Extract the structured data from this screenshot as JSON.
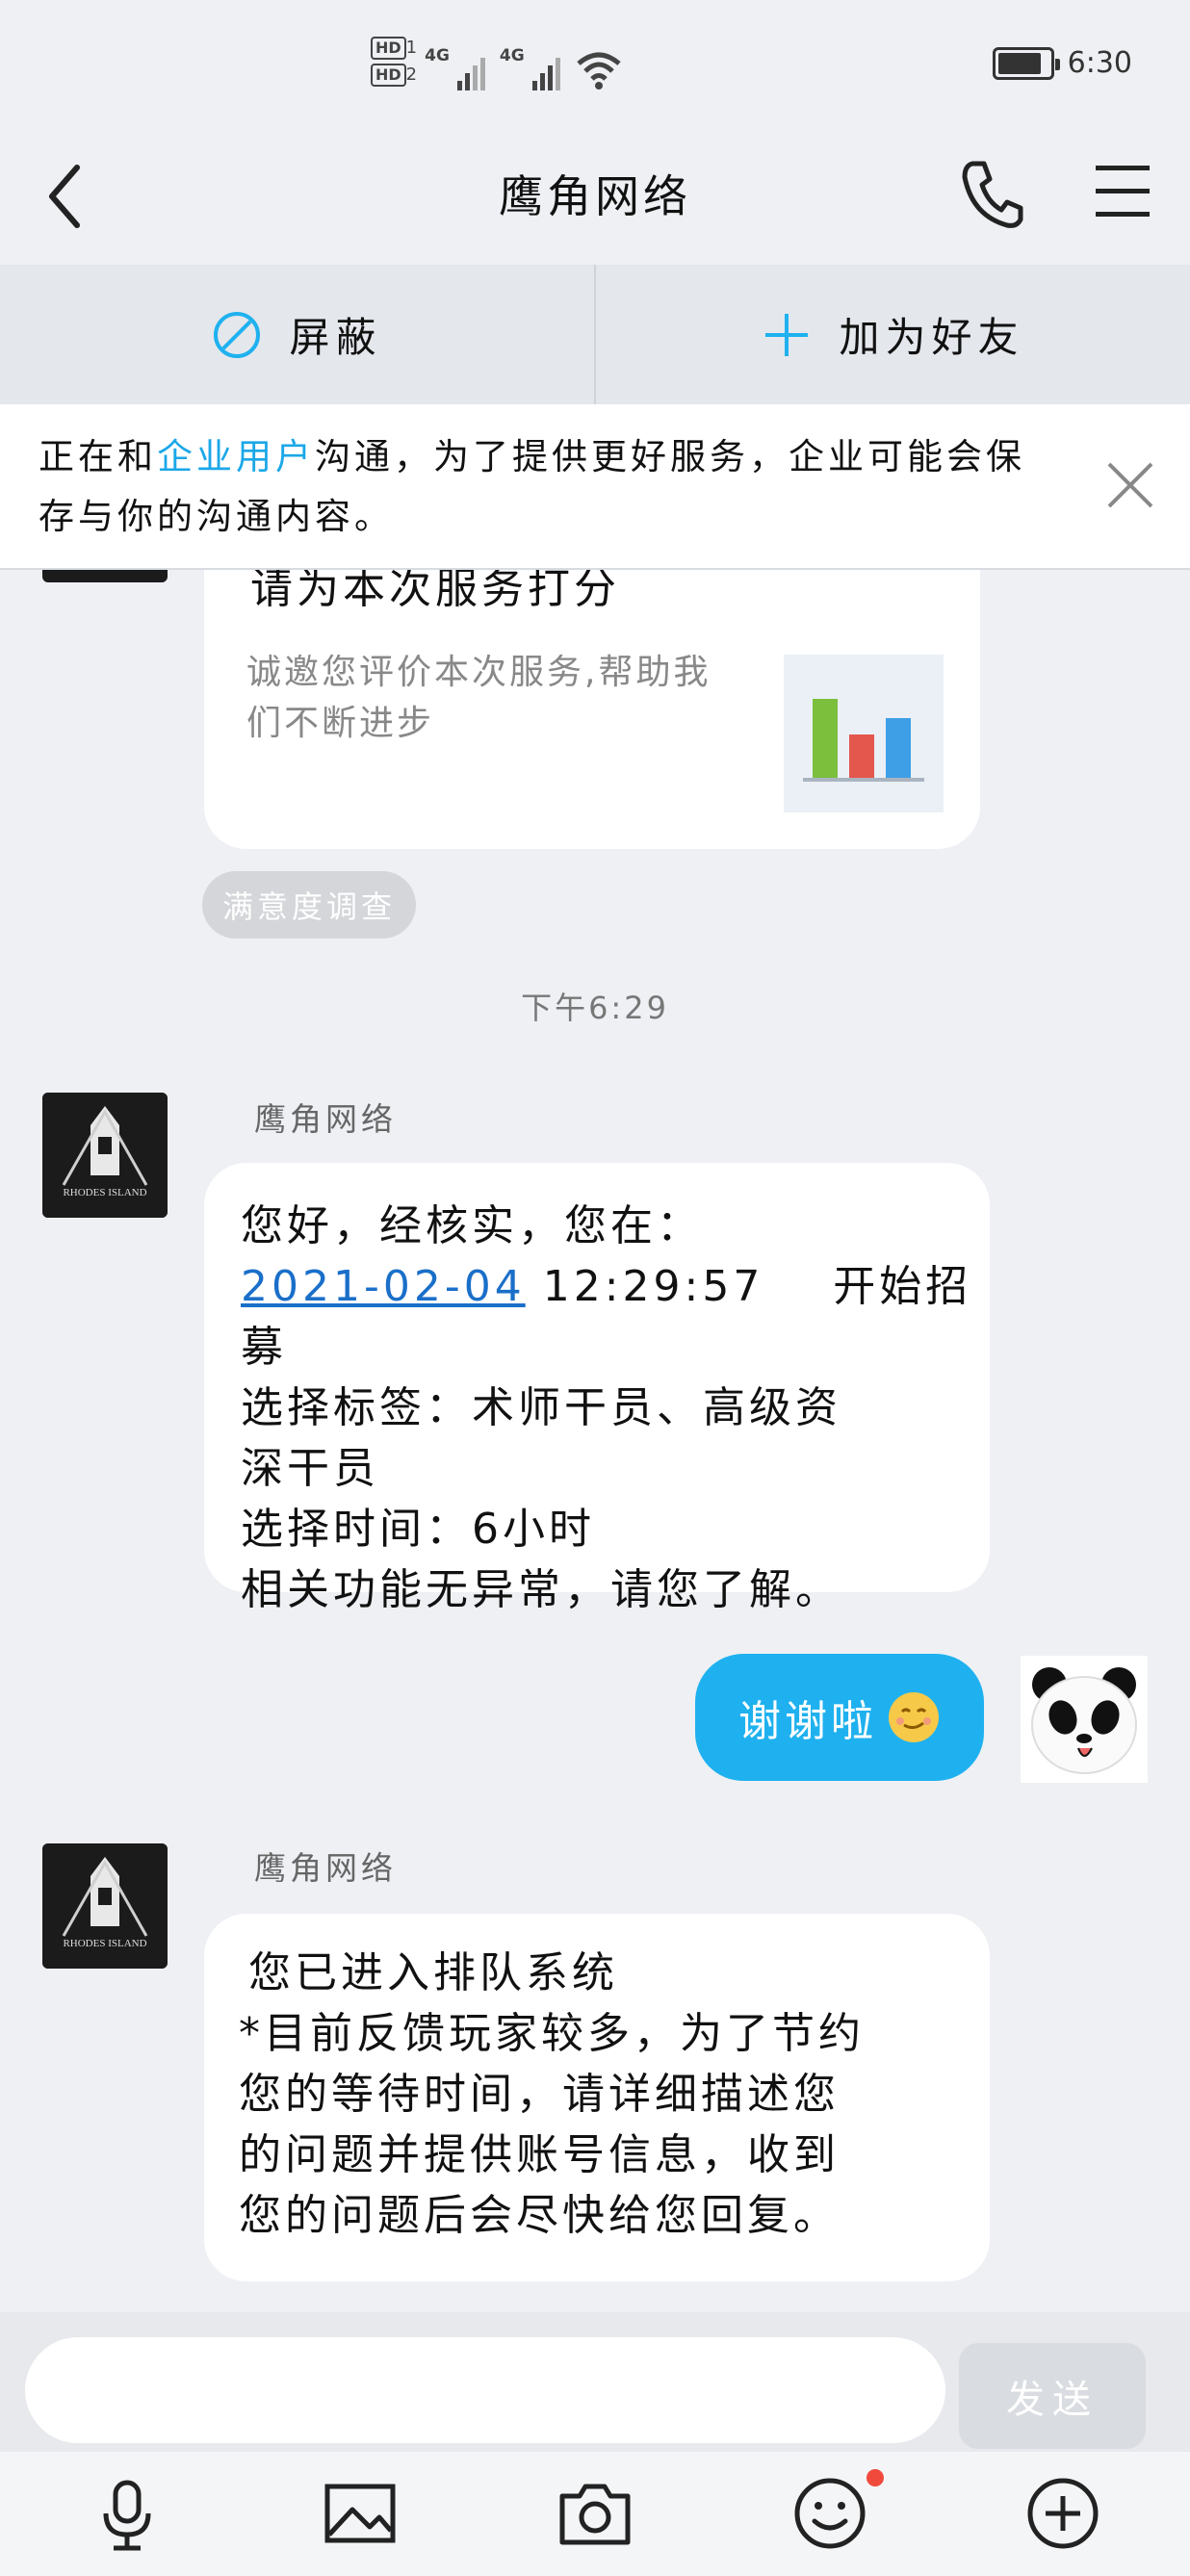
{
  "status_bar": {
    "hd1": "HD",
    "hd1_sub": "1",
    "hd2": "HD",
    "hd2_sub": "2",
    "net1": "4G",
    "net2": "4G",
    "time": "6:30"
  },
  "header": {
    "title": "鹰角网络"
  },
  "actions": {
    "block_label": "屏蔽",
    "add_friend_label": "加为好友"
  },
  "notice": {
    "prefix": "正在和",
    "highlight": "企业用户",
    "suffix": "沟通，为了提供更好服务，企业可能会保存与你的沟通内容。"
  },
  "rating_card": {
    "title": "请为本次服务打分",
    "description": "诚邀您评价本次服务,帮助我们不断进步",
    "chip": "满意度调查",
    "bar_values": [
      0.82,
      0.45,
      0.62
    ],
    "bar_colors": [
      "#7bbf3c",
      "#e4574c",
      "#3e9ee6"
    ]
  },
  "timestamp": "下午6:29",
  "messages": [
    {
      "sender": "鹰角网络",
      "line1": "您好，经核实，您在：",
      "date": "2021-02-04",
      "time": "12:29:57",
      "action": "开始招募",
      "line3": "选择标签：术师干员、高级资",
      "line4": "深干员",
      "line5": "选择时间：6小时",
      "line6": "相关功能无异常，请您了解。"
    },
    {
      "text": "谢谢啦"
    },
    {
      "sender": "鹰角网络",
      "line1": "您已进入排队系统",
      "line2": "*目前反馈玩家较多，为了节约",
      "line3": "您的等待时间，请详细描述您",
      "line4": "的问题并提供账号信息，收到",
      "line5": "您的问题后会尽快给您回复。"
    }
  ],
  "avatar": {
    "caption": "RHODES ISLAND"
  },
  "input": {
    "placeholder": "",
    "send_label": "发送"
  },
  "colors": {
    "accent": "#1fb1ef",
    "badge": "#f04a3c"
  }
}
